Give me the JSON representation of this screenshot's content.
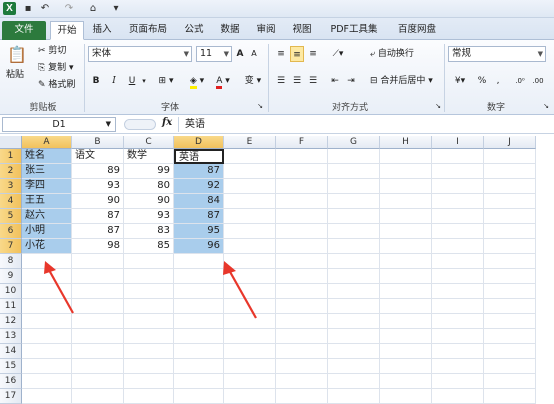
{
  "app": {
    "icon_letter": "X"
  },
  "tabs": [
    {
      "label": "文件"
    },
    {
      "label": "开始"
    },
    {
      "label": "插入"
    },
    {
      "label": "页面布局"
    },
    {
      "label": "公式"
    },
    {
      "label": "数据"
    },
    {
      "label": "审阅"
    },
    {
      "label": "视图"
    },
    {
      "label": "PDF工具集"
    },
    {
      "label": "百度网盘"
    }
  ],
  "ribbon": {
    "clipboard": {
      "paste": "粘贴",
      "cut": "剪切",
      "copy": "复制",
      "format_painter": "格式刷",
      "label": "剪贴板"
    },
    "font": {
      "name": "宋体",
      "size": "11",
      "label": "字体",
      "bold": "B",
      "italic": "I",
      "underline": "U",
      "grow": "A",
      "shrink": "A",
      "font_color": "A",
      "phonetic": "变"
    },
    "alignment": {
      "wrap": "自动换行",
      "merge": "合并后居中",
      "label": "对齐方式"
    },
    "number": {
      "format": "常规",
      "percent": "%",
      "comma": ",",
      "label": "数字"
    }
  },
  "formula_bar": {
    "name_box": "D1",
    "fx": "fx",
    "value": "英语"
  },
  "columns": [
    "A",
    "B",
    "C",
    "D",
    "E",
    "F",
    "G",
    "H",
    "I",
    "J"
  ],
  "rows": [
    "1",
    "2",
    "3",
    "4",
    "5",
    "6",
    "7",
    "8",
    "9",
    "10",
    "11",
    "12",
    "13",
    "14",
    "15",
    "16",
    "17"
  ],
  "sheet": {
    "header": [
      "姓名",
      "语文",
      "数学",
      "英语"
    ],
    "data": [
      [
        "张三",
        "89",
        "99",
        "87"
      ],
      [
        "李四",
        "93",
        "80",
        "92"
      ],
      [
        "王五",
        "90",
        "90",
        "84"
      ],
      [
        "赵六",
        "87",
        "93",
        "87"
      ],
      [
        "小明",
        "87",
        "83",
        "95"
      ],
      [
        "小花",
        "98",
        "85",
        "96"
      ]
    ]
  },
  "colors": {
    "selection": "#a9cdec",
    "arrow": "#e8372b",
    "file_tab": "#2c7a3d"
  }
}
